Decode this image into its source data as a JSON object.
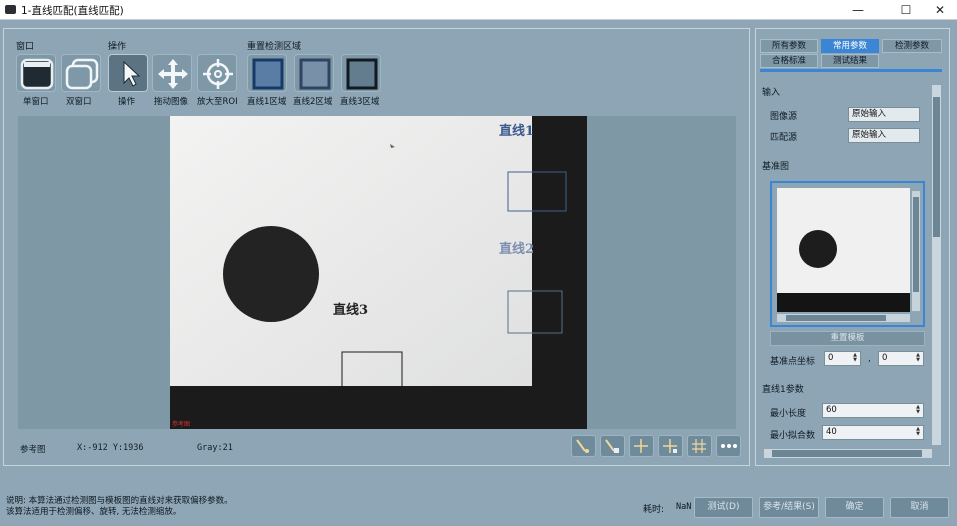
{
  "window": {
    "title": "1-直线匹配(直线匹配)",
    "minimize": "—",
    "maximize": "☐",
    "close": "✕"
  },
  "toolbar": {
    "groups": {
      "window": "窗口",
      "operation": "操作",
      "reset_region": "重置检测区域"
    },
    "tools": {
      "single_window": "单窗口",
      "dual_window": "双窗口",
      "operate": "操作",
      "drag_image": "拖动图像",
      "zoom_roi": "放大至ROI",
      "line1_region": "直线1区域",
      "line2_region": "直线2区域",
      "line3_region": "直线3区域"
    }
  },
  "image": {
    "labels": {
      "line1": "直线1",
      "line2": "直线2",
      "line3": "直线3"
    },
    "corner_tag": "参考图"
  },
  "status": {
    "view_name": "参考图",
    "coords": "X:-912 Y:1936",
    "gray": "Gray:21"
  },
  "side": {
    "tabs": {
      "all_params": "所有参数",
      "common_params": "常用参数",
      "detect_params": "检测参数",
      "criteria": "合格标准",
      "test_result": "测试结果"
    },
    "input_section": "输入",
    "image_source_label": "图像源",
    "image_source_value": "原始输入",
    "match_source_label": "匹配源",
    "match_source_value": "原始输入",
    "reference_section": "基准图",
    "reset_template": "重置模板",
    "ref_point_label": "基准点坐标",
    "ref_x": "0",
    "ref_sep": ",",
    "ref_y": "0",
    "line1_section": "直线1参数",
    "min_length_label": "最小长度",
    "min_length_value": "60",
    "min_fit_label": "最小拟合数",
    "min_fit_value": "40"
  },
  "footer": {
    "desc_line1": "说明: 本算法通过检测图与模板图的直线对来获取偏移参数。",
    "desc_line2": "该算法适用于检测偏移、旋转, 无法检测缩放。",
    "time_label": "耗时:",
    "time_value": "NaN",
    "test_button": "测试(D)",
    "ref_result_button": "参考/结果(S)",
    "ok_button": "确定",
    "cancel_button": "取消"
  },
  "colors": {
    "accent": "#3a86d4",
    "panel": "#8da5b4",
    "roi_box": "#3f5f8e"
  }
}
